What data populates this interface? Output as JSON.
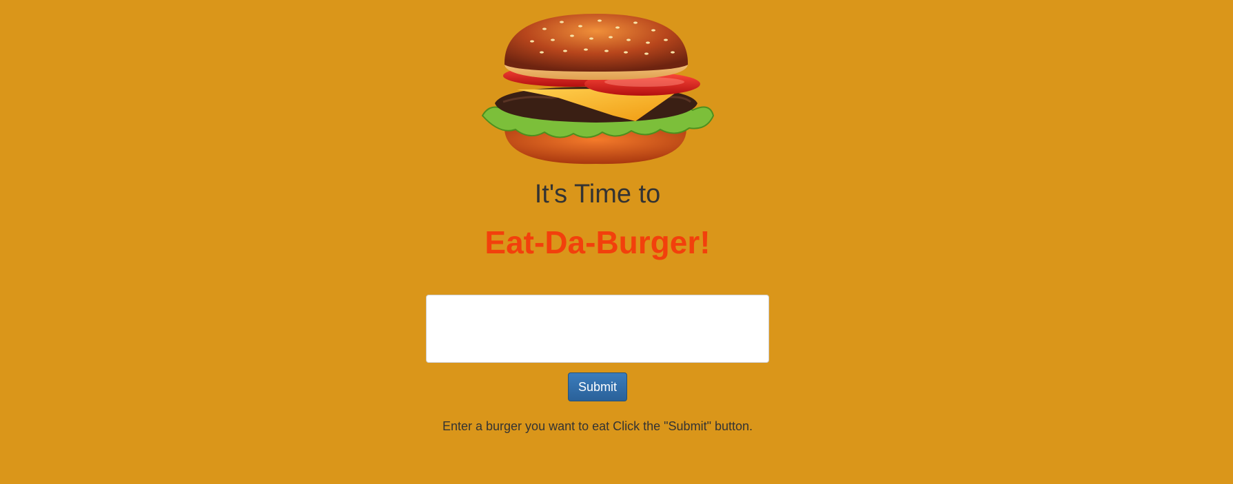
{
  "header": {
    "logo_icon": "hamburger-icon",
    "subtitle": "It's Time to",
    "brand": "Eat-Da-Burger!"
  },
  "form": {
    "input_value": "",
    "submit_label": "Submit",
    "hint": "Enter a burger you want to eat Click the \"Submit\" button."
  },
  "colors": {
    "background": "#DA961A",
    "brand": "#F2400C",
    "text": "#333333",
    "button": "#2E6DA4"
  }
}
